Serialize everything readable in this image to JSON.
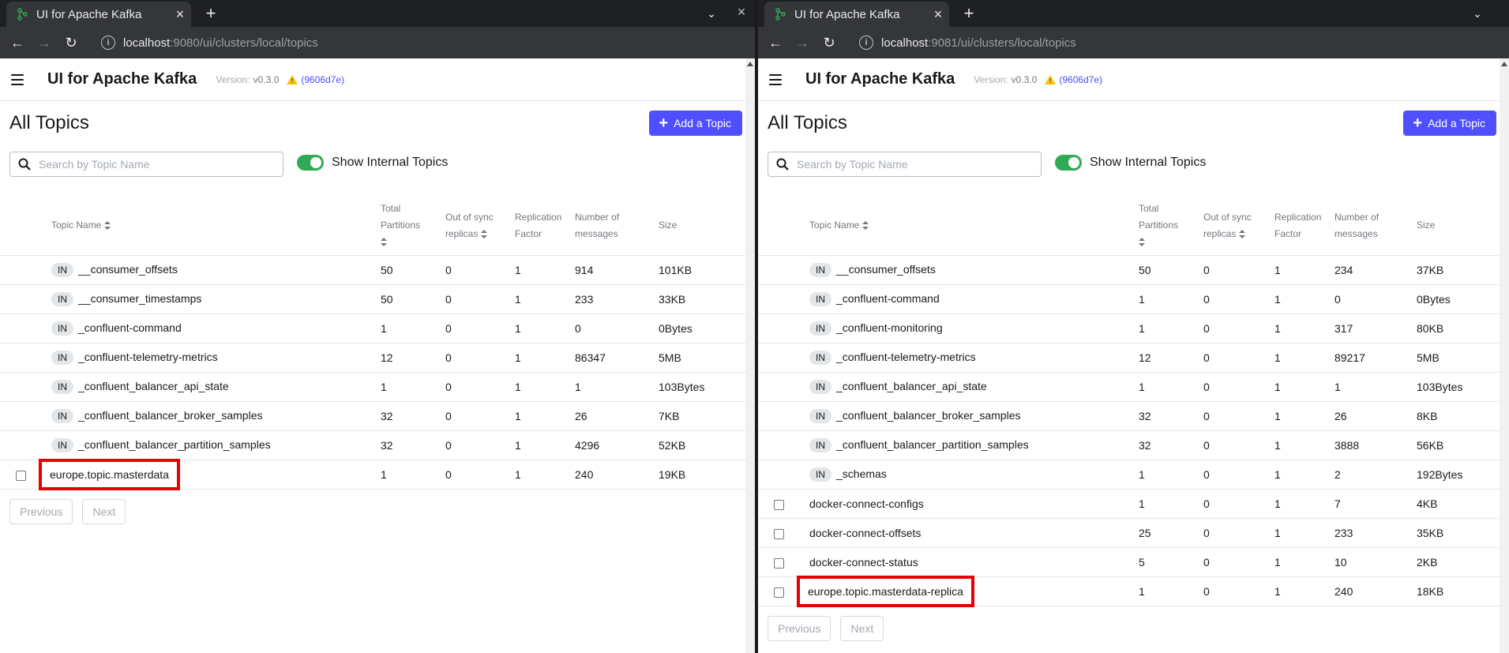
{
  "windows": [
    {
      "tab_title": "UI for Apache Kafka",
      "address_host": "localhost",
      "address_rest": ":9080/ui/clusters/local/topics",
      "app": {
        "title": "UI for Apache Kafka",
        "version_label": "Version:",
        "version": "v0.3.0",
        "commit": "(9606d7e)",
        "page_title": "All Topics",
        "add_button": "Add a Topic",
        "search_placeholder": "Search by Topic Name",
        "toggle_label": "Show Internal Topics",
        "headers": {
          "name": "Topic Name",
          "partitions": "Total Partitions",
          "out_of_sync": "Out of sync replicas",
          "replication": "Replication Factor",
          "messages": "Number of messages",
          "size": "Size"
        },
        "internal_badge": "IN",
        "rows": [
          {
            "name": "__consumer_offsets",
            "internal": true,
            "partitions": "50",
            "out_of_sync": "0",
            "replication": "1",
            "messages": "914",
            "size": "101KB"
          },
          {
            "name": "__consumer_timestamps",
            "internal": true,
            "partitions": "50",
            "out_of_sync": "0",
            "replication": "1",
            "messages": "233",
            "size": "33KB"
          },
          {
            "name": "_confluent-command",
            "internal": true,
            "partitions": "1",
            "out_of_sync": "0",
            "replication": "1",
            "messages": "0",
            "size": "0Bytes"
          },
          {
            "name": "_confluent-telemetry-metrics",
            "internal": true,
            "partitions": "12",
            "out_of_sync": "0",
            "replication": "1",
            "messages": "86347",
            "size": "5MB"
          },
          {
            "name": "_confluent_balancer_api_state",
            "internal": true,
            "partitions": "1",
            "out_of_sync": "0",
            "replication": "1",
            "messages": "1",
            "size": "103Bytes"
          },
          {
            "name": "_confluent_balancer_broker_samples",
            "internal": true,
            "partitions": "32",
            "out_of_sync": "0",
            "replication": "1",
            "messages": "26",
            "size": "7KB"
          },
          {
            "name": "_confluent_balancer_partition_samples",
            "internal": true,
            "partitions": "32",
            "out_of_sync": "0",
            "replication": "1",
            "messages": "4296",
            "size": "52KB"
          },
          {
            "name": "europe.topic.masterdata",
            "internal": false,
            "highlighted": true,
            "partitions": "1",
            "out_of_sync": "0",
            "replication": "1",
            "messages": "240",
            "size": "19KB"
          }
        ],
        "previous": "Previous",
        "next": "Next"
      }
    },
    {
      "tab_title": "UI for Apache Kafka",
      "address_host": "localhost",
      "address_rest": ":9081/ui/clusters/local/topics",
      "app": {
        "title": "UI for Apache Kafka",
        "version_label": "Version:",
        "version": "v0.3.0",
        "commit": "(9606d7e)",
        "page_title": "All Topics",
        "add_button": "Add a Topic",
        "search_placeholder": "Search by Topic Name",
        "toggle_label": "Show Internal Topics",
        "headers": {
          "name": "Topic Name",
          "partitions": "Total Partitions",
          "out_of_sync": "Out of sync replicas",
          "replication": "Replication Factor",
          "messages": "Number of messages",
          "size": "Size"
        },
        "internal_badge": "IN",
        "rows": [
          {
            "name": "__consumer_offsets",
            "internal": true,
            "partitions": "50",
            "out_of_sync": "0",
            "replication": "1",
            "messages": "234",
            "size": "37KB"
          },
          {
            "name": "_confluent-command",
            "internal": true,
            "partitions": "1",
            "out_of_sync": "0",
            "replication": "1",
            "messages": "0",
            "size": "0Bytes"
          },
          {
            "name": "_confluent-monitoring",
            "internal": true,
            "partitions": "1",
            "out_of_sync": "0",
            "replication": "1",
            "messages": "317",
            "size": "80KB"
          },
          {
            "name": "_confluent-telemetry-metrics",
            "internal": true,
            "partitions": "12",
            "out_of_sync": "0",
            "replication": "1",
            "messages": "89217",
            "size": "5MB"
          },
          {
            "name": "_confluent_balancer_api_state",
            "internal": true,
            "partitions": "1",
            "out_of_sync": "0",
            "replication": "1",
            "messages": "1",
            "size": "103Bytes"
          },
          {
            "name": "_confluent_balancer_broker_samples",
            "internal": true,
            "partitions": "32",
            "out_of_sync": "0",
            "replication": "1",
            "messages": "26",
            "size": "8KB"
          },
          {
            "name": "_confluent_balancer_partition_samples",
            "internal": true,
            "partitions": "32",
            "out_of_sync": "0",
            "replication": "1",
            "messages": "3888",
            "size": "56KB"
          },
          {
            "name": "_schemas",
            "internal": true,
            "partitions": "1",
            "out_of_sync": "0",
            "replication": "1",
            "messages": "2",
            "size": "192Bytes"
          },
          {
            "name": "docker-connect-configs",
            "internal": false,
            "partitions": "1",
            "out_of_sync": "0",
            "replication": "1",
            "messages": "7",
            "size": "4KB"
          },
          {
            "name": "docker-connect-offsets",
            "internal": false,
            "partitions": "25",
            "out_of_sync": "0",
            "replication": "1",
            "messages": "233",
            "size": "35KB"
          },
          {
            "name": "docker-connect-status",
            "internal": false,
            "partitions": "5",
            "out_of_sync": "0",
            "replication": "1",
            "messages": "10",
            "size": "2KB"
          },
          {
            "name": "europe.topic.masterdata-replica",
            "internal": false,
            "highlighted": true,
            "partitions": "1",
            "out_of_sync": "0",
            "replication": "1",
            "messages": "240",
            "size": "18KB"
          }
        ],
        "previous": "Previous",
        "next": "Next"
      }
    }
  ],
  "colors": {
    "accent": "#4f4fff",
    "toggle_on": "#2eab54",
    "highlight": "#e60000",
    "commit_link": "#4c4cff"
  },
  "icons": {
    "favicon": "kafka-logo-icon",
    "warning": "warning-icon",
    "search": "search-icon",
    "sort": "sort-icon",
    "menu": "hamburger-menu-icon"
  }
}
